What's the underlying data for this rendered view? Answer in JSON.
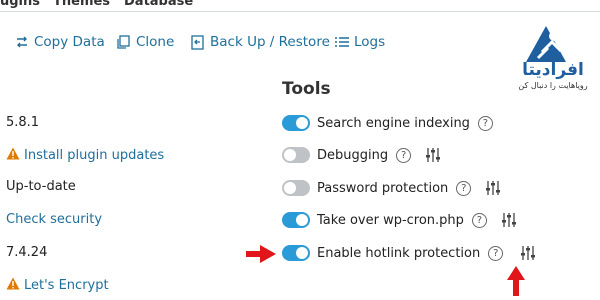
{
  "top_nav": [
    "ugins",
    "Themes",
    "Database"
  ],
  "toolbar": {
    "copy_data": "Copy Data",
    "clone": "Clone",
    "backup": "Back Up / Restore",
    "logs": "Logs"
  },
  "tools_heading": "Tools",
  "left_column": {
    "wp_version": "5.8.1",
    "install_updates": "Install plugin updates",
    "status": "Up-to-date",
    "check_security": "Check security",
    "php_version": "7.4.24",
    "lets_encrypt": "Let's Encrypt"
  },
  "tools": [
    {
      "label": "Search engine indexing",
      "enabled": true,
      "has_settings": false
    },
    {
      "label": "Debugging",
      "enabled": false,
      "has_settings": true
    },
    {
      "label": "Password protection",
      "enabled": false,
      "has_settings": true
    },
    {
      "label": "Take over wp-cron.php",
      "enabled": true,
      "has_settings": true
    },
    {
      "label": "Enable hotlink protection",
      "enabled": true,
      "has_settings": true
    }
  ],
  "help_symbol": "?",
  "logo": {
    "name": "افرادیتا",
    "tagline": "رویاهایت را دنبال کن"
  },
  "colors": {
    "accent": "#2b9bd8",
    "link": "#1f6f9a",
    "warning": "#e07b00",
    "annotation_red": "#e0161b"
  }
}
